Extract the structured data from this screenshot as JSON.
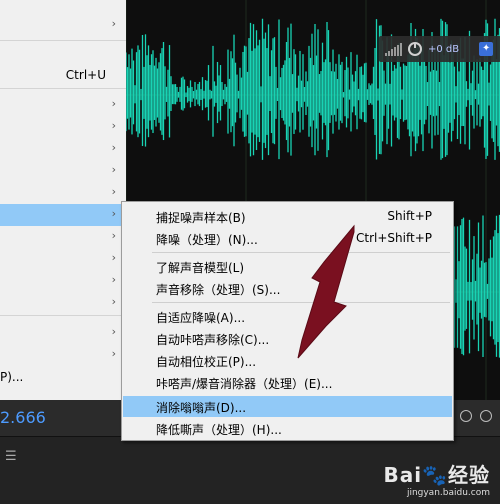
{
  "left_menu": {
    "items": [
      {
        "label": "",
        "shortcut": "",
        "arrow": "›"
      },
      {
        "label": "",
        "shortcut": "Ctrl+U",
        "arrow": ""
      },
      {
        "label": "",
        "shortcut": "",
        "arrow": "›"
      },
      {
        "label": "",
        "shortcut": "",
        "arrow": "›"
      },
      {
        "label": "",
        "shortcut": "",
        "arrow": "›"
      },
      {
        "label": "",
        "shortcut": "",
        "arrow": "›"
      },
      {
        "label": "",
        "shortcut": "",
        "arrow": "›"
      },
      {
        "label": "",
        "shortcut": "",
        "arrow": "›"
      },
      {
        "label": "",
        "shortcut": "",
        "arrow": "›"
      },
      {
        "label": "",
        "shortcut": "",
        "arrow": "›"
      },
      {
        "label": "",
        "shortcut": "",
        "arrow": "›"
      },
      {
        "label": "",
        "shortcut": "",
        "arrow": "›"
      },
      {
        "label": "",
        "shortcut": "",
        "arrow": "›"
      },
      {
        "label": "",
        "shortcut": "",
        "arrow": "›"
      },
      {
        "label": "P)...",
        "shortcut": "",
        "arrow": ""
      }
    ]
  },
  "hud": {
    "gain": "+0 dB"
  },
  "timecode": "2.666",
  "submenu": {
    "items": [
      {
        "label": "捕捉噪声样本(B)",
        "shortcut": "Shift+P"
      },
      {
        "label": "降噪（处理）(N)...",
        "shortcut": "Ctrl+Shift+P"
      },
      {
        "label": "了解声音模型(L)",
        "shortcut": ""
      },
      {
        "label": "声音移除（处理）(S)...",
        "shortcut": ""
      },
      {
        "label": "自适应降噪(A)...",
        "shortcut": ""
      },
      {
        "label": "自动咔嗒声移除(C)...",
        "shortcut": ""
      },
      {
        "label": "自动相位校正(P)...",
        "shortcut": ""
      },
      {
        "label": "咔嗒声/爆音消除器（处理）(E)...",
        "shortcut": ""
      },
      {
        "label": "消除嗡嗡声(D)...",
        "shortcut": ""
      },
      {
        "label": "降低嘶声（处理）(H)...",
        "shortcut": ""
      }
    ],
    "highlighted_index": 8
  },
  "watermark": {
    "logo": "Bai🐾经验",
    "url": "jingyan.baidu.com"
  },
  "colors": {
    "waveform": "#19d3b4",
    "highlight": "#91c9f7",
    "timecode": "#4d9bff",
    "annotation_arrow": "#7a1020"
  }
}
